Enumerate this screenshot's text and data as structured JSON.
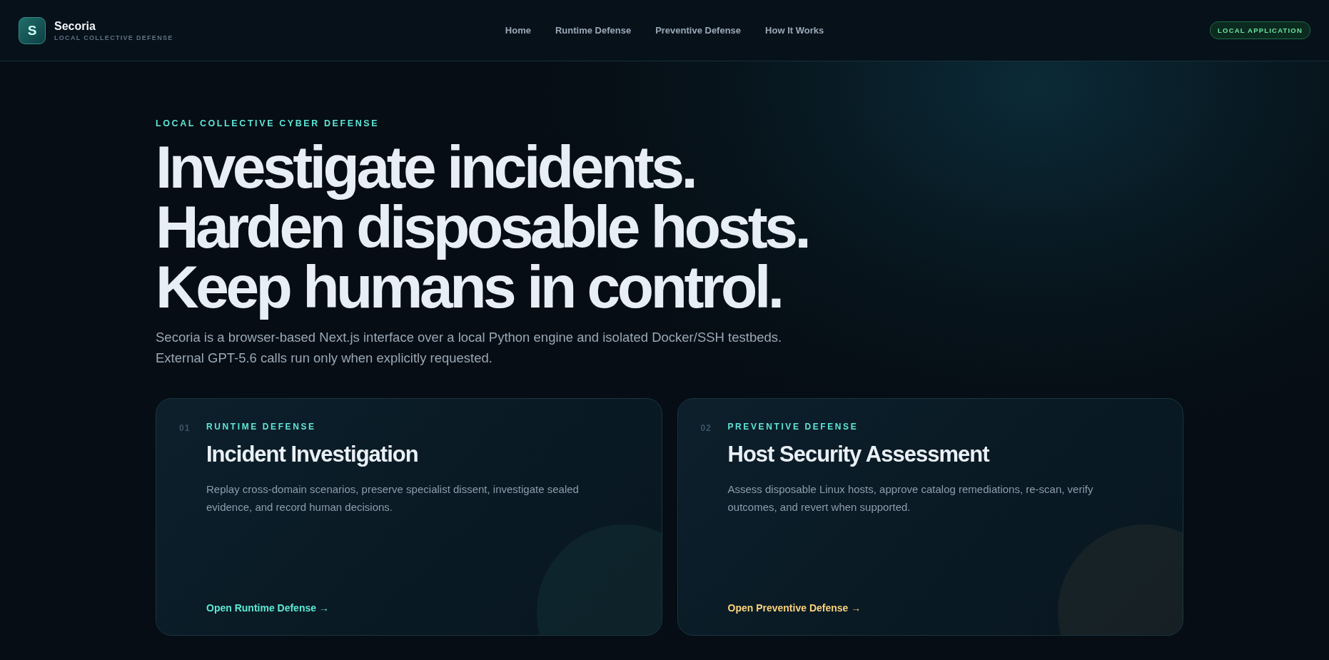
{
  "brand": {
    "logo_letter": "S",
    "name": "Secoria",
    "tagline": "LOCAL COLLECTIVE DEFENSE"
  },
  "nav": [
    {
      "label": "Home"
    },
    {
      "label": "Runtime Defense"
    },
    {
      "label": "Preventive Defense"
    },
    {
      "label": "How It Works"
    }
  ],
  "badge": "LOCAL APPLICATION",
  "hero": {
    "eyebrow": "LOCAL COLLECTIVE CYBER DEFENSE",
    "headline": "Investigate incidents. Harden disposable hosts. Keep humans in control.",
    "description": "Secoria is a browser-based Next.js interface over a local Python engine and isolated Docker/SSH testbeds. External GPT-5.6 calls run only when explicitly requested."
  },
  "cards": [
    {
      "number": "01",
      "category": "RUNTIME DEFENSE",
      "title": "Incident Investigation",
      "description": "Replay cross-domain scenarios, preserve specialist dissent, investigate sealed evidence, and record human decisions.",
      "link": "Open Runtime Defense →",
      "color": "#5eead4"
    },
    {
      "number": "02",
      "category": "PREVENTIVE DEFENSE",
      "title": "Host Security Assessment",
      "description": "Assess disposable Linux hosts, approve catalog remediations, re-scan, verify outcomes, and revert when supported.",
      "link": "Open Preventive Defense →",
      "color": "#fcd27a"
    }
  ]
}
